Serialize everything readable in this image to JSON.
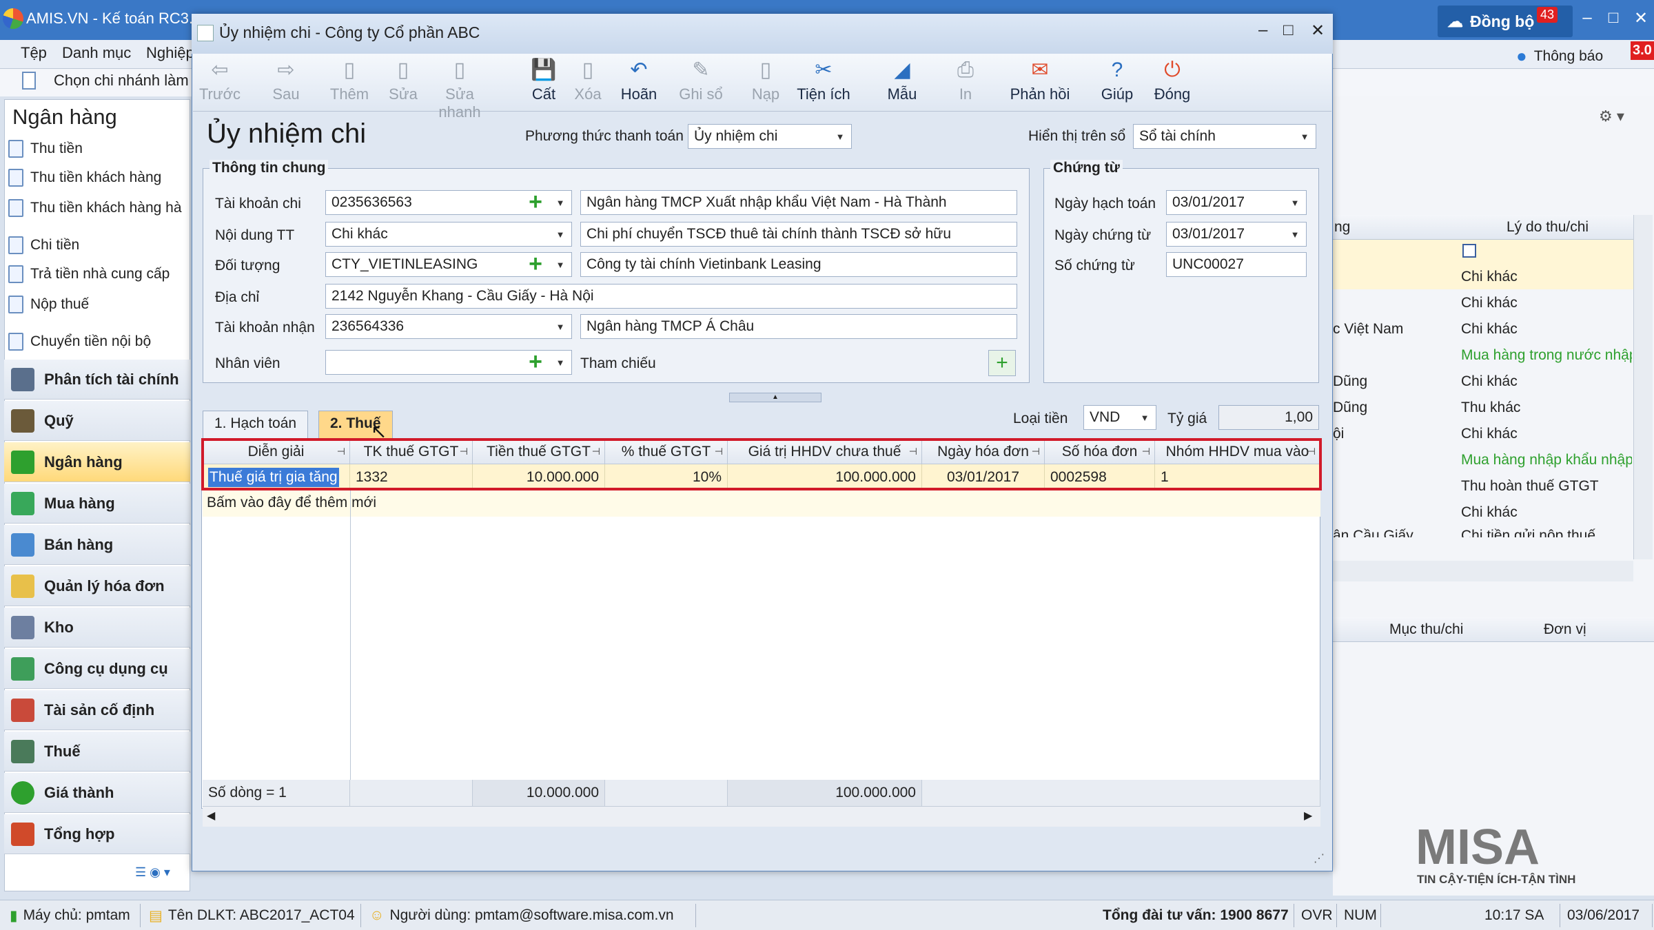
{
  "app": {
    "title": "AMIS.VN - Kế toán RC3.",
    "sync_label": "Đồng bộ",
    "sync_count": "43",
    "notify_label": "Thông báo",
    "notify_count": "3.0"
  },
  "menu": [
    "Tệp",
    "Danh mục",
    "Nghiệp"
  ],
  "branch_label": "Chọn chi nhánh làm",
  "sidebar": {
    "title": "Ngân hàng",
    "items": [
      "Thu tiền",
      "Thu tiền khách hàng",
      "Thu tiền khách hàng hà",
      "Chi tiền",
      "Trả tiền nhà cung cấp",
      "Nộp thuế",
      "Chuyển tiền nội bộ"
    ],
    "modules": [
      "Phân tích tài chính",
      "Quỹ",
      "Ngân hàng",
      "Mua hàng",
      "Bán hàng",
      "Quản lý hóa đơn",
      "Kho",
      "Công cụ dụng cụ",
      "Tài sản cố định",
      "Thuế",
      "Giá thành",
      "Tổng hợp"
    ]
  },
  "right_panel": {
    "col1": "ng",
    "col2": "Lý do thu/chi",
    "cells": [
      "Chi khác",
      "Chi khác",
      "c Việt Nam",
      "Chi khác",
      "Mua hàng trong nước nhập",
      "Dũng",
      "Chi khác",
      "Dũng",
      "Thu khác",
      "ội",
      "Chi khác",
      "Mua hàng nhập khẩu nhập",
      "Thu hoàn thuế GTGT",
      "Chi khác",
      "ận Cầu Giấy",
      "Chi tiền gửi nộp thuế"
    ],
    "bottom_cols": [
      "Mục thu/chi",
      "Đơn vị"
    ]
  },
  "dialog": {
    "title": "Ủy nhiệm chi - Công ty Cổ phần ABC",
    "toolbar": [
      {
        "label": "Trước",
        "enabled": false,
        "glyph": "⇦"
      },
      {
        "label": "Sau",
        "enabled": false,
        "glyph": "⇨"
      },
      {
        "label": "Thêm",
        "enabled": false,
        "glyph": "▯"
      },
      {
        "label": "Sửa",
        "enabled": false,
        "glyph": "▯"
      },
      {
        "label": "Sửa nhanh",
        "enabled": false,
        "glyph": "▯"
      },
      {
        "label": "Cất",
        "enabled": true,
        "glyph": "💾"
      },
      {
        "label": "Xóa",
        "enabled": false,
        "glyph": "▯"
      },
      {
        "label": "Hoãn",
        "enabled": true,
        "glyph": "↶"
      },
      {
        "label": "Ghi sổ",
        "enabled": false,
        "glyph": "✎"
      },
      {
        "label": "Nạp",
        "enabled": false,
        "glyph": "▯"
      },
      {
        "label": "Tiện ích",
        "enabled": true,
        "glyph": "✂"
      },
      {
        "label": "Mẫu",
        "enabled": true,
        "glyph": "◢"
      },
      {
        "label": "In",
        "enabled": false,
        "glyph": "⎙"
      },
      {
        "label": "Phản hồi",
        "enabled": true,
        "glyph": "✉"
      },
      {
        "label": "Giúp",
        "enabled": true,
        "glyph": "?"
      },
      {
        "label": "Đóng",
        "enabled": true,
        "glyph": "⏻"
      }
    ],
    "form_title": "Ủy nhiệm chi",
    "payment_method_label": "Phương thức thanh toán",
    "payment_method": "Ủy nhiệm chi",
    "ledger_label": "Hiển thị trên sổ",
    "ledger": "Sổ tài chính",
    "general": {
      "title": "Thông tin chung",
      "pay_account_label": "Tài khoản chi",
      "pay_account": "0235636563",
      "pay_bank": "Ngân hàng TMCP Xuất nhập khẩu Việt Nam - Hà Thành",
      "content_label": "Nội dung TT",
      "content": "Chi khác",
      "content_desc": "Chi phí chuyển TSCĐ thuê tài chính thành TSCĐ sở hữu",
      "object_label": "Đối tượng",
      "object": "CTY_VIETINLEASING",
      "object_name": "Công ty tài chính Vietinbank Leasing",
      "address_label": "Địa chỉ",
      "address": "2142 Nguyễn Khang - Cầu Giấy - Hà Nội",
      "recv_account_label": "Tài khoản nhận",
      "recv_account": "236564336",
      "recv_bank": "Ngân hàng TMCP Á Châu",
      "employee_label": "Nhân viên",
      "employee": "",
      "reference_label": "Tham chiếu"
    },
    "voucher": {
      "title": "Chứng từ",
      "post_date_label": "Ngày hạch toán",
      "post_date": "03/01/2017",
      "doc_date_label": "Ngày chứng từ",
      "doc_date": "03/01/2017",
      "doc_no_label": "Số chứng từ",
      "doc_no": "UNC00027"
    },
    "tabs": [
      "1. Hạch toán",
      "2. Thuế"
    ],
    "currency_label": "Loại tiền",
    "currency": "VND",
    "rate_label": "Tỷ giá",
    "rate": "1,00",
    "grid": {
      "headers": [
        "Diễn giải",
        "TK thuế GTGT",
        "Tiền thuế GTGT",
        "% thuế GTGT",
        "Giá trị HHDV chưa thuế",
        "Ngày hóa đơn",
        "Số hóa đơn",
        "Nhóm HHDV mua vào"
      ],
      "row": [
        "Thuế giá trị gia tăng",
        "1332",
        "10.000.000",
        "10%",
        "100.000.000",
        "03/01/2017",
        "0002598",
        "1"
      ],
      "add_hint": "Bấm vào đây để thêm mới",
      "footer": {
        "rows": "Số dòng = 1",
        "tax_total": "10.000.000",
        "value_total": "100.000.000"
      }
    }
  },
  "brand": {
    "name": "MISA",
    "tagline": "TIN CẬY-TIỆN ÍCH-TẬN TÌNH"
  },
  "status": {
    "server": "Máy chủ: pmtam",
    "db": "Tên DLKT: ABC2017_ACT04",
    "user": "Người dùng: pmtam@software.misa.com.vn",
    "hotline": "Tổng đài tư vấn: 1900 8677",
    "ovr": "OVR",
    "num": "NUM",
    "time": "10:17 SA",
    "date": "03/06/2017"
  },
  "colors": {
    "titlebar": "#3a78c6",
    "highlight": "#ffd88a",
    "red_box": "#d11a2a",
    "green_text": "#2ea02e"
  }
}
